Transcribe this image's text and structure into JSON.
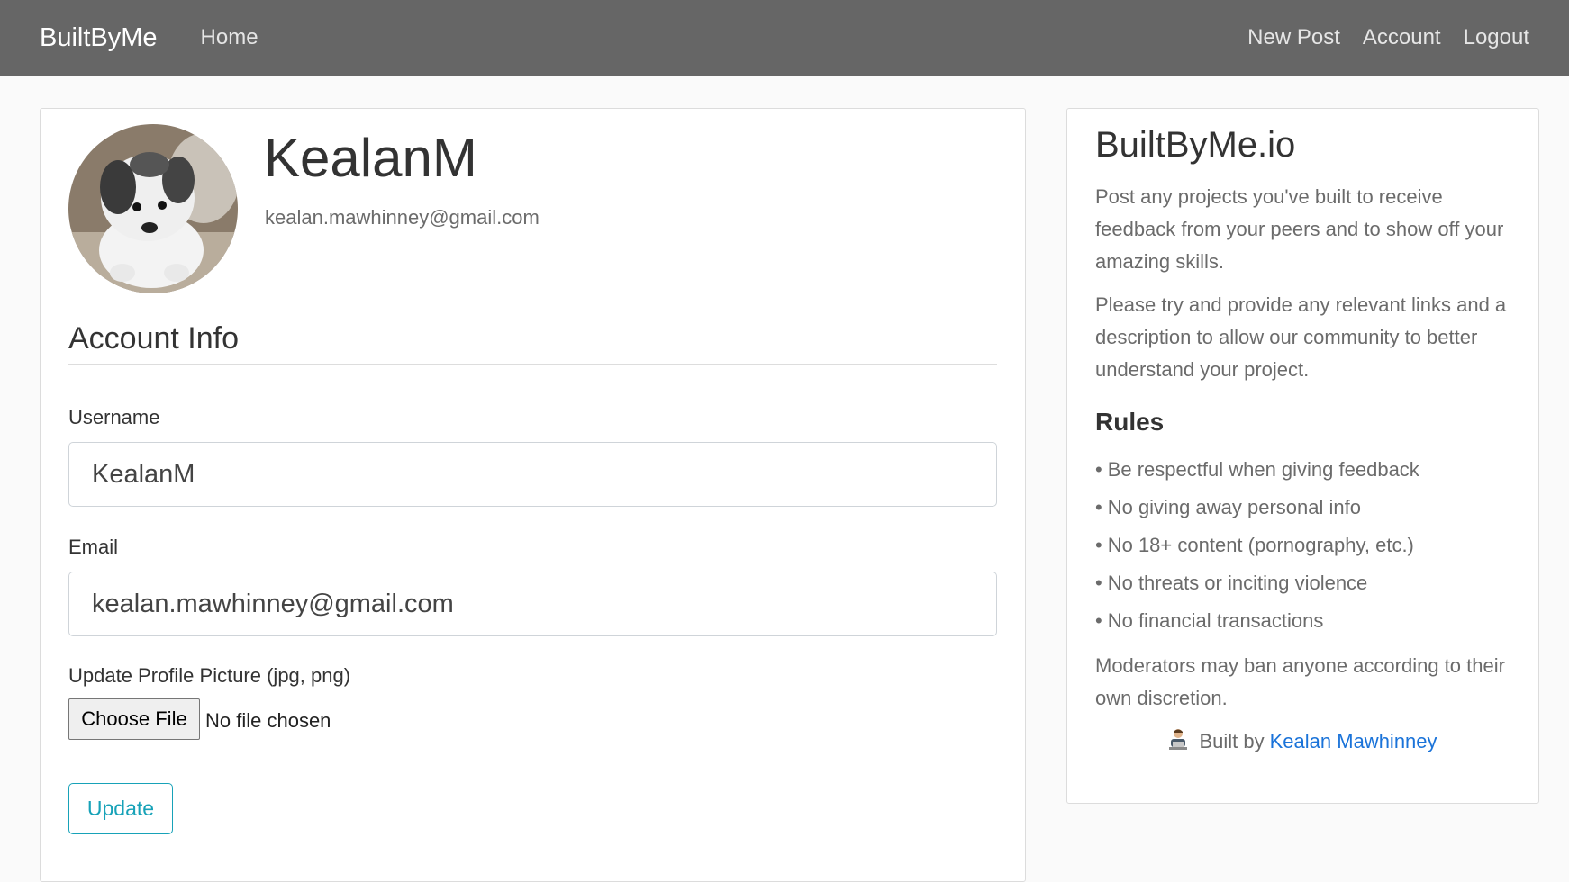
{
  "navbar": {
    "brand": "BuiltByMe",
    "home": "Home",
    "new_post": "New Post",
    "account": "Account",
    "logout": "Logout"
  },
  "profile": {
    "username": "KealanM",
    "email": "kealan.mawhinney@gmail.com"
  },
  "account_form": {
    "section_title": "Account Info",
    "username_label": "Username",
    "username_value": "KealanM",
    "email_label": "Email",
    "email_value": "kealan.mawhinney@gmail.com",
    "picture_label": "Update Profile Picture (jpg, png)",
    "choose_file_label": "Choose File",
    "file_status": "No file chosen",
    "update_label": "Update"
  },
  "sidebar": {
    "title": "BuiltByMe.io",
    "intro": "Post any projects you've built to receive feedback from your peers and to show off your amazing skills.",
    "instructions": "Please try and provide any relevant links and a description to allow our community to better understand your project.",
    "rules_title": "Rules",
    "rules": [
      "Be respectful when giving feedback",
      "No giving away personal info",
      "No 18+ content (pornography, etc.)",
      "No threats or inciting violence",
      "No financial transactions"
    ],
    "moderation": "Moderators may ban anyone according to their own discretion.",
    "credit_prefix": "Built by",
    "credit_name": "Kealan Mawhinney"
  },
  "icons": {
    "avatar": "dog-avatar-image",
    "developer": "technologist-icon"
  },
  "colors": {
    "navbar_bg": "#666666",
    "accent": "#17a2b8",
    "link": "#1a73d9"
  }
}
